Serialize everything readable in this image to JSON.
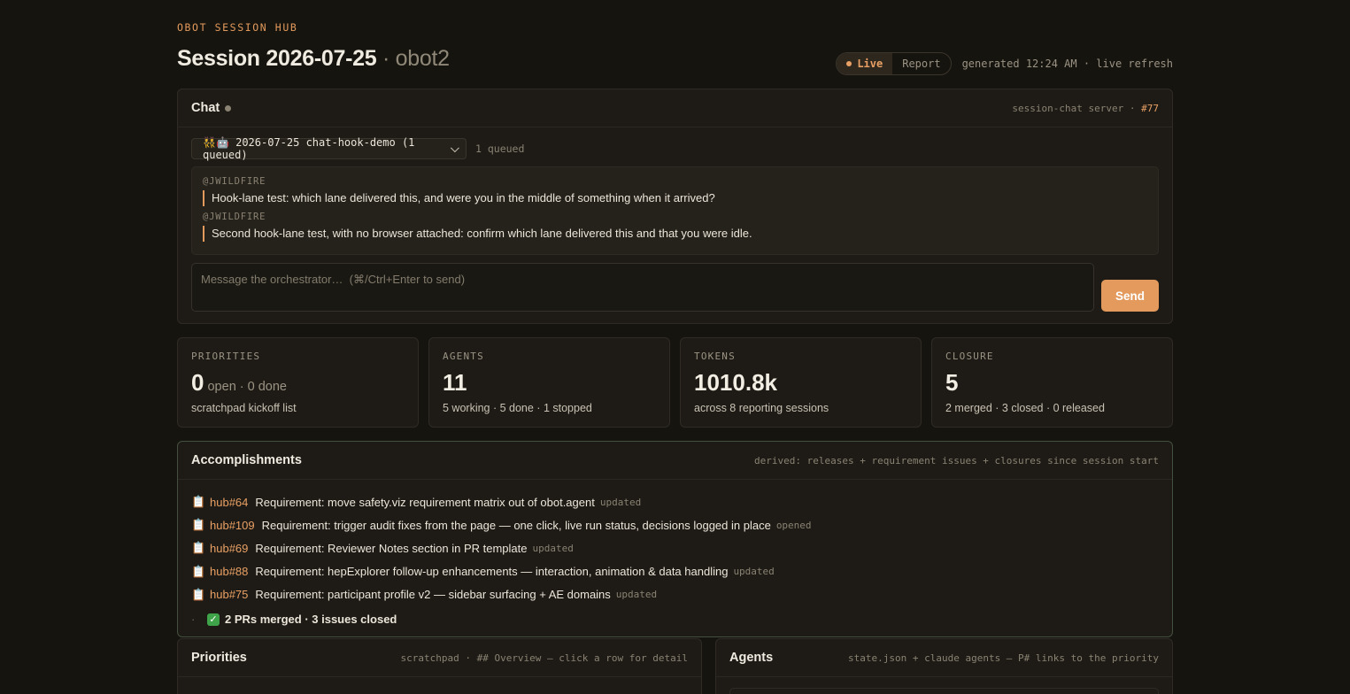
{
  "header": {
    "eyebrow": "OBOT SESSION HUB",
    "title": "Session 2026-07-25",
    "subtitle": " · obot2",
    "mode_live": "Live",
    "mode_report": "Report",
    "generated": "generated 12:24 AM · live refresh"
  },
  "chat": {
    "title": "Chat",
    "meta": "session-chat server · ",
    "meta_ref": "#77",
    "selector": "👯🤖 2026-07-25 chat-hook-demo (1 queued)",
    "queued": "1 queued",
    "messages": [
      {
        "author": "@JWILDFIRE",
        "text": "Hook-lane test: which lane delivered this, and were you in the middle of something when it arrived?"
      },
      {
        "author": "@JWILDFIRE",
        "text": "Second hook-lane test, with no browser attached: confirm which lane delivered this and that you were idle."
      }
    ],
    "placeholder": "Message the orchestrator…  (⌘/Ctrl+Enter to send)",
    "send": "Send"
  },
  "stats": [
    {
      "label": "PRIORITIES",
      "value": "0",
      "unit": " open · 0 done",
      "sub": "scratchpad kickoff list"
    },
    {
      "label": "AGENTS",
      "value": "11",
      "unit": "",
      "sub": "5 working · 5 done · 1 stopped"
    },
    {
      "label": "TOKENS",
      "value": "1010.8k",
      "unit": "",
      "sub": "across 8 reporting sessions"
    },
    {
      "label": "CLOSURE",
      "value": "5",
      "unit": "",
      "sub": "2 merged · 3 closed · 0 released"
    }
  ],
  "accomplishments": {
    "title": "Accomplishments",
    "meta": "derived: releases + requirement issues + closures since session start",
    "items": [
      {
        "ref": "hub#64",
        "text": "Requirement: move safety.viz requirement matrix out of obot.agent",
        "tag": "updated"
      },
      {
        "ref": "hub#109",
        "text": "Requirement: trigger audit fixes from the page — one click, live run status, decisions logged in place",
        "tag": "opened"
      },
      {
        "ref": "hub#69",
        "text": "Requirement: Reviewer Notes section in PR template",
        "tag": "updated"
      },
      {
        "ref": "hub#88",
        "text": "Requirement: hepExplorer follow-up enhancements — interaction, animation & data handling",
        "tag": "updated"
      },
      {
        "ref": "hub#75",
        "text": "Requirement: participant profile v2 — sidebar surfacing + AE domains",
        "tag": "updated"
      }
    ],
    "summary": "2 PRs merged · 3 issues closed"
  },
  "priorities": {
    "title": "Priorities",
    "meta": "scratchpad · ## Overview — click a row for detail"
  },
  "agents": {
    "title": "Agents",
    "meta": "state.json + claude agents — P# links to the priority"
  }
}
